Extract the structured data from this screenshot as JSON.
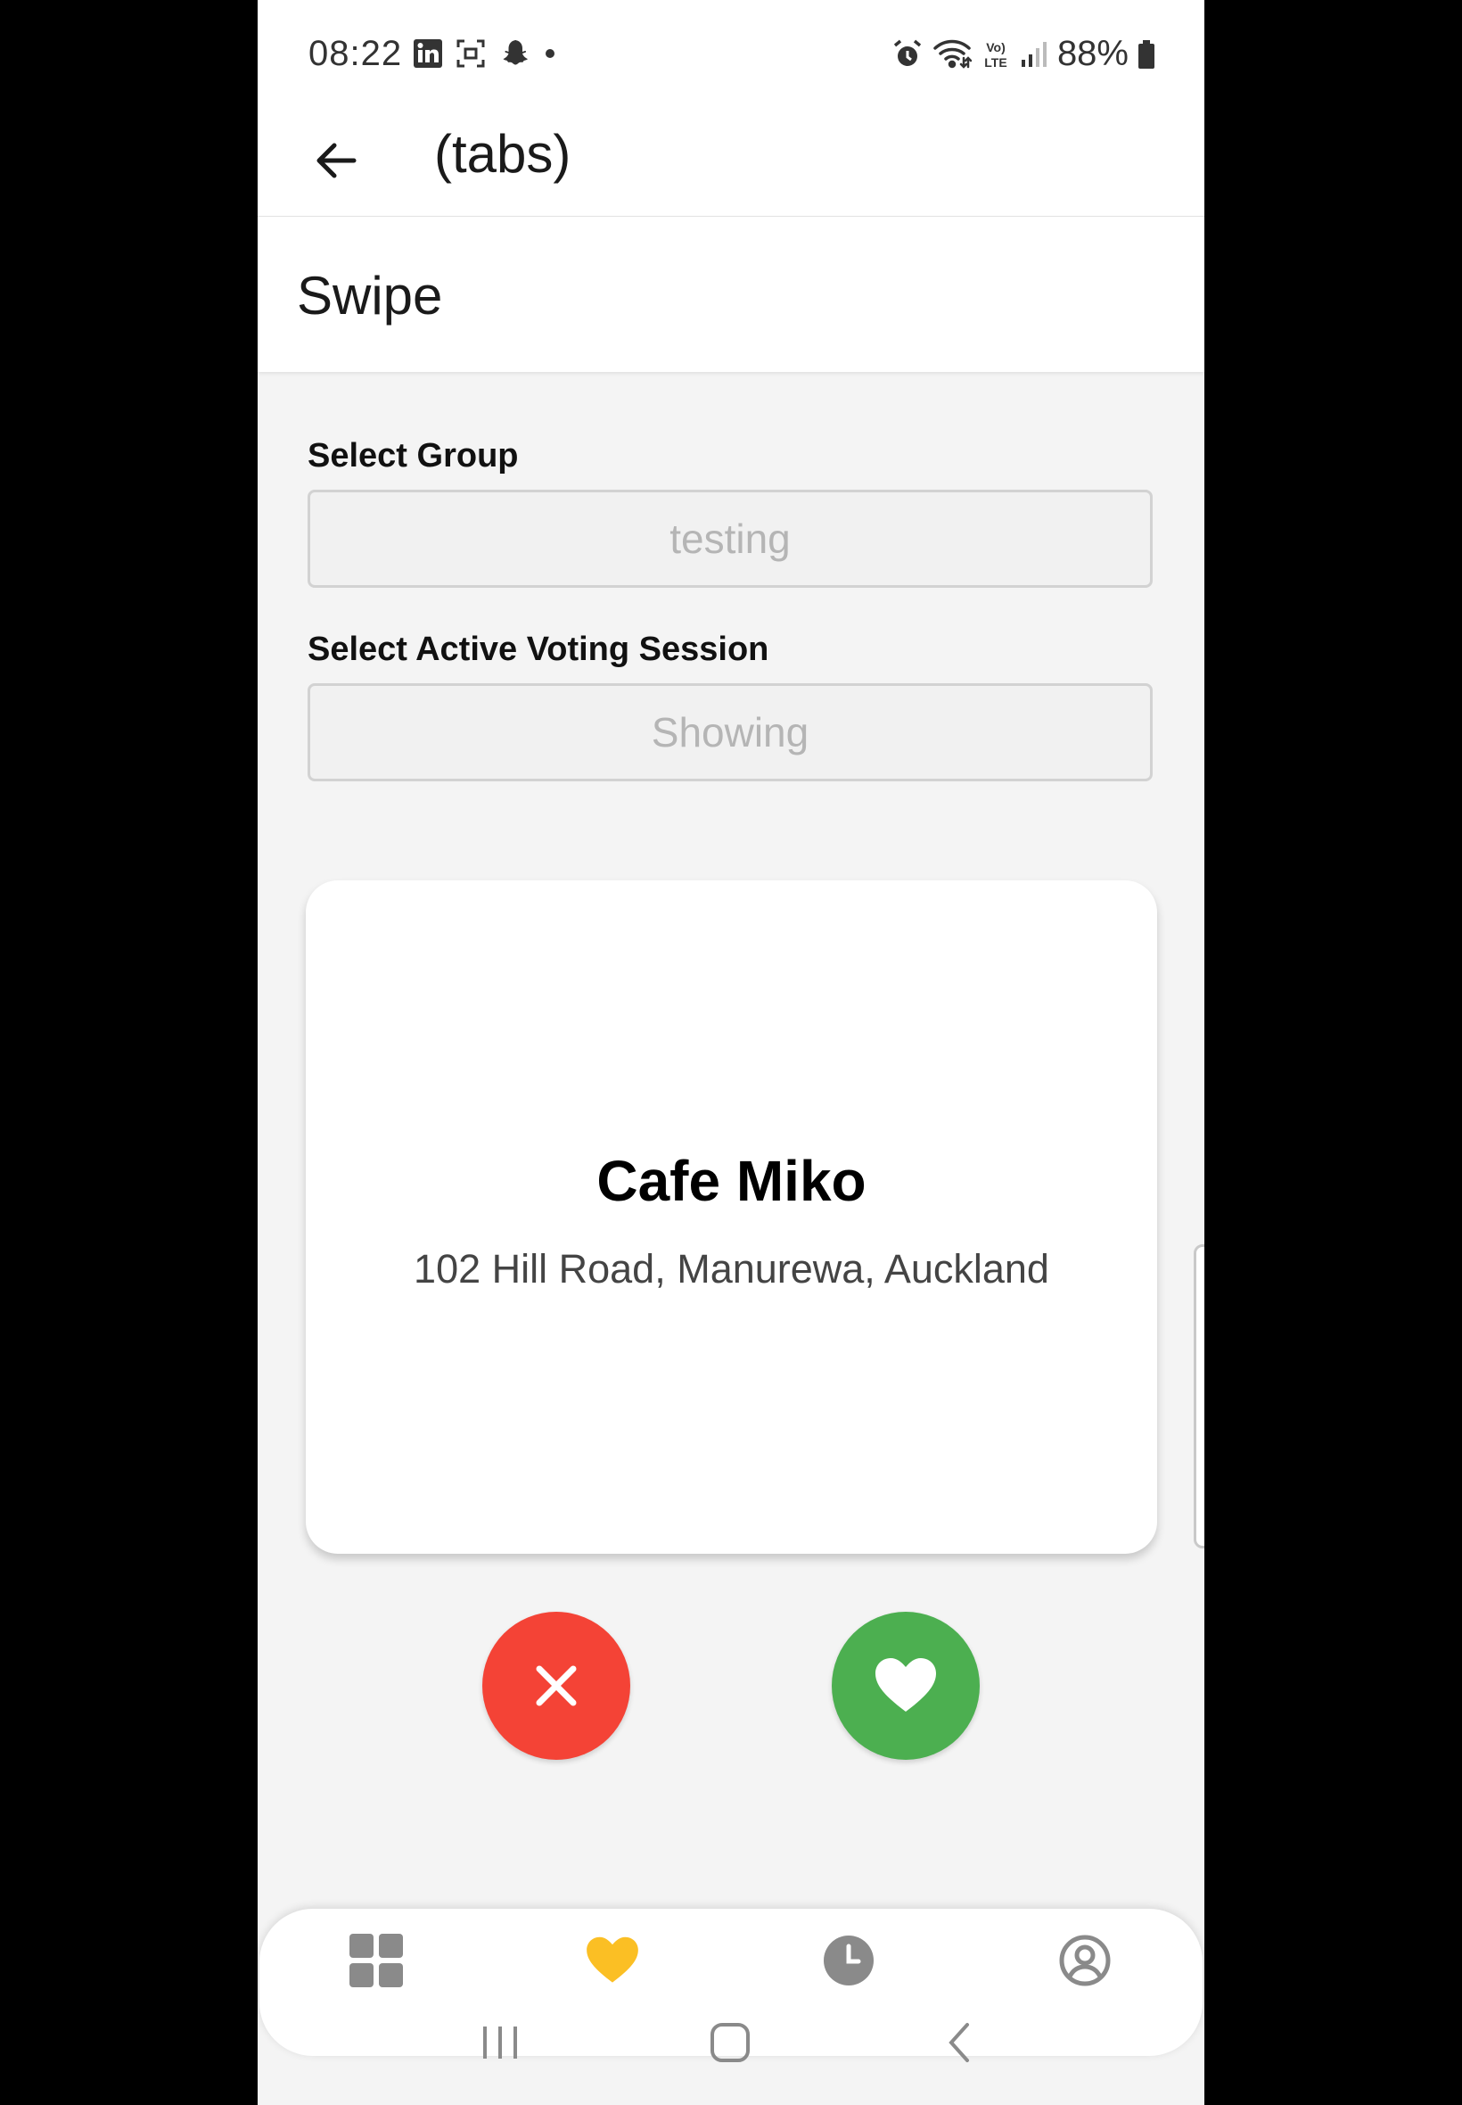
{
  "status_bar": {
    "time": "08:22",
    "battery": "88%",
    "left_icons": [
      "linkedin-icon",
      "screenshot-icon",
      "snapchat-icon",
      "dot-icon"
    ],
    "right_icons": [
      "alarm-icon",
      "wifi-icon",
      "volte-icon",
      "signal-icon",
      "battery-icon"
    ]
  },
  "header": {
    "title": "(tabs)",
    "back_icon": "arrow-left-icon"
  },
  "page": {
    "title": "Swipe"
  },
  "group_select": {
    "label": "Select Group",
    "value": "testing"
  },
  "session_select": {
    "label": "Select Active Voting Session",
    "value": "Showing"
  },
  "card": {
    "name": "Cafe Miko",
    "address": "102 Hill Road, Manurewa, Auckland"
  },
  "actions": {
    "dislike_icon": "close-icon",
    "like_icon": "heart-icon",
    "dislike_color": "#f44336",
    "like_color": "#4caf50"
  },
  "tabs": [
    {
      "icon": "grid-icon",
      "active": false
    },
    {
      "icon": "heart-icon",
      "active": true,
      "color": "#fbbf24"
    },
    {
      "icon": "clock-icon",
      "active": false
    },
    {
      "icon": "profile-icon",
      "active": false
    }
  ],
  "system_nav": [
    "recents-icon",
    "home-icon",
    "back-icon"
  ]
}
